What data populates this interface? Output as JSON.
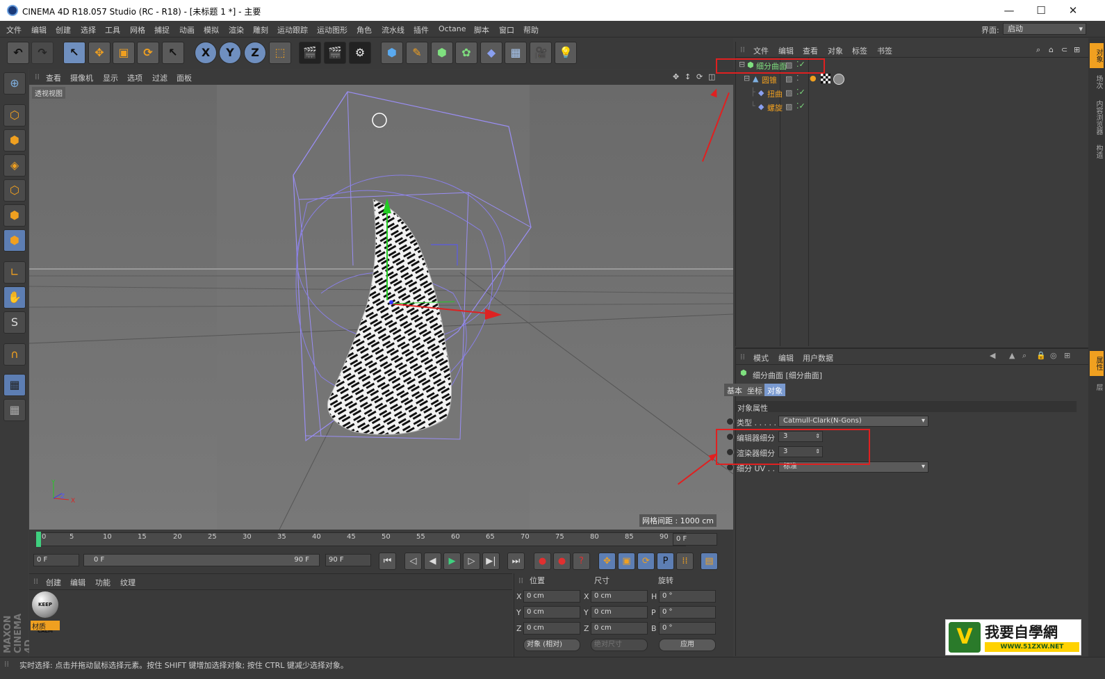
{
  "window": {
    "title": "CINEMA 4D R18.057 Studio (RC - R18) - [未标题 1 *] - 主要",
    "min": "—",
    "max": "☐",
    "close": "✕"
  },
  "menu": [
    "文件",
    "编辑",
    "创建",
    "选择",
    "工具",
    "网格",
    "捕捉",
    "动画",
    "模拟",
    "渲染",
    "雕刻",
    "运动跟踪",
    "运动图形",
    "角色",
    "流水线",
    "插件",
    "Octane",
    "脚本",
    "窗口",
    "帮助"
  ],
  "interface": {
    "label": "界面:",
    "value": "启动"
  },
  "toolbar": {
    "undo": "↶",
    "redo": "↷",
    "select": "↖",
    "move": "✥",
    "scale": "▣",
    "rotate": "⟳",
    "live": "↖",
    "x": "X",
    "y": "Y",
    "z": "Z",
    "coord": "⬚",
    "render_view": "🎬",
    "render_pv": "🎬",
    "render_settings": "⚙",
    "cube": "⬢",
    "pen": "✎",
    "subdiv": "⬢",
    "cloner": "✿",
    "deformer": "◆",
    "floor": "▦",
    "camera": "🎥",
    "light": "💡"
  },
  "left_tools": [
    "⊕",
    "⬡",
    "⬢",
    "◈",
    "⬡",
    "⬢",
    "⬢",
    "∟",
    "✋",
    "S",
    "∩",
    "▦",
    "▦"
  ],
  "viewport": {
    "menu": [
      "查看",
      "摄像机",
      "显示",
      "选项",
      "过滤",
      "面板"
    ],
    "label": "透视视图",
    "grid": "网格间距 : 1000 cm",
    "axis": {
      "y": "Y",
      "x": "X",
      "z": "Z"
    }
  },
  "timeline": {
    "ticks": [
      "0",
      "5",
      "10",
      "15",
      "20",
      "25",
      "30",
      "35",
      "40",
      "45",
      "50",
      "55",
      "60",
      "65",
      "70",
      "75",
      "80",
      "85",
      "90"
    ],
    "current": "0 F",
    "start": "0 F",
    "range_left": "0 F",
    "range_right": "90 F",
    "end": "90 F"
  },
  "transport": [
    "⏮",
    "◁",
    "◀",
    "▶",
    "▷",
    "▶|",
    "⏭"
  ],
  "keys": [
    "●",
    "●",
    "?",
    "✥",
    "▣",
    "⟳",
    "P",
    "⁞⁞"
  ],
  "material": {
    "menu": [
      "创建",
      "编辑",
      "功能",
      "纹理"
    ],
    "name": "材质",
    "ball": "KEEP CALM"
  },
  "coords": {
    "headers": [
      "位置",
      "尺寸",
      "旋转"
    ],
    "rows": [
      [
        "X",
        "0 cm",
        "X",
        "0 cm",
        "H",
        "0 °"
      ],
      [
        "Y",
        "0 cm",
        "Y",
        "0 cm",
        "P",
        "0 °"
      ],
      [
        "Z",
        "0 cm",
        "Z",
        "0 cm",
        "B",
        "0 °"
      ]
    ],
    "mode": "对象 (相对)",
    "size_mode": "绝对尺寸",
    "apply": "应用"
  },
  "status": "实时选择: 点击并拖动鼠标选择元素。按住 SHIFT 键增加选择对象; 按住 CTRL 键减少选择对象。",
  "objmgr": {
    "menu": [
      "文件",
      "编辑",
      "查看",
      "对象",
      "标签",
      "书签"
    ],
    "objects": [
      {
        "name": "细分曲面",
        "color": "#7fe07f"
      },
      {
        "name": "圆锥",
        "color": "#f0a020"
      },
      {
        "name": "扭曲",
        "color": "#f0a020"
      },
      {
        "name": "螺旋",
        "color": "#f0a020"
      }
    ]
  },
  "attrmgr": {
    "menu": [
      "模式",
      "编辑",
      "用户数据"
    ],
    "title": "细分曲面 [细分曲面]",
    "tabs": [
      "基本",
      "坐标",
      "对象"
    ],
    "section": "对象属性",
    "type_label": "类型 . . . . .",
    "type_value": "Catmull-Clark(N-Gons)",
    "editor_label": "编辑器细分",
    "editor_value": "3",
    "render_label": "渲染器细分",
    "render_value": "3",
    "uv_label": "细分 UV . .",
    "uv_value": "标准"
  },
  "side_tabs": [
    "对象",
    "场次",
    "内容浏览器",
    "构造",
    "属性",
    "层"
  ],
  "watermark": {
    "cn": "我要自學網",
    "url": "WWW.51ZXW.NET",
    "logo": "V"
  },
  "brand": "MAXON CINEMA 4D"
}
